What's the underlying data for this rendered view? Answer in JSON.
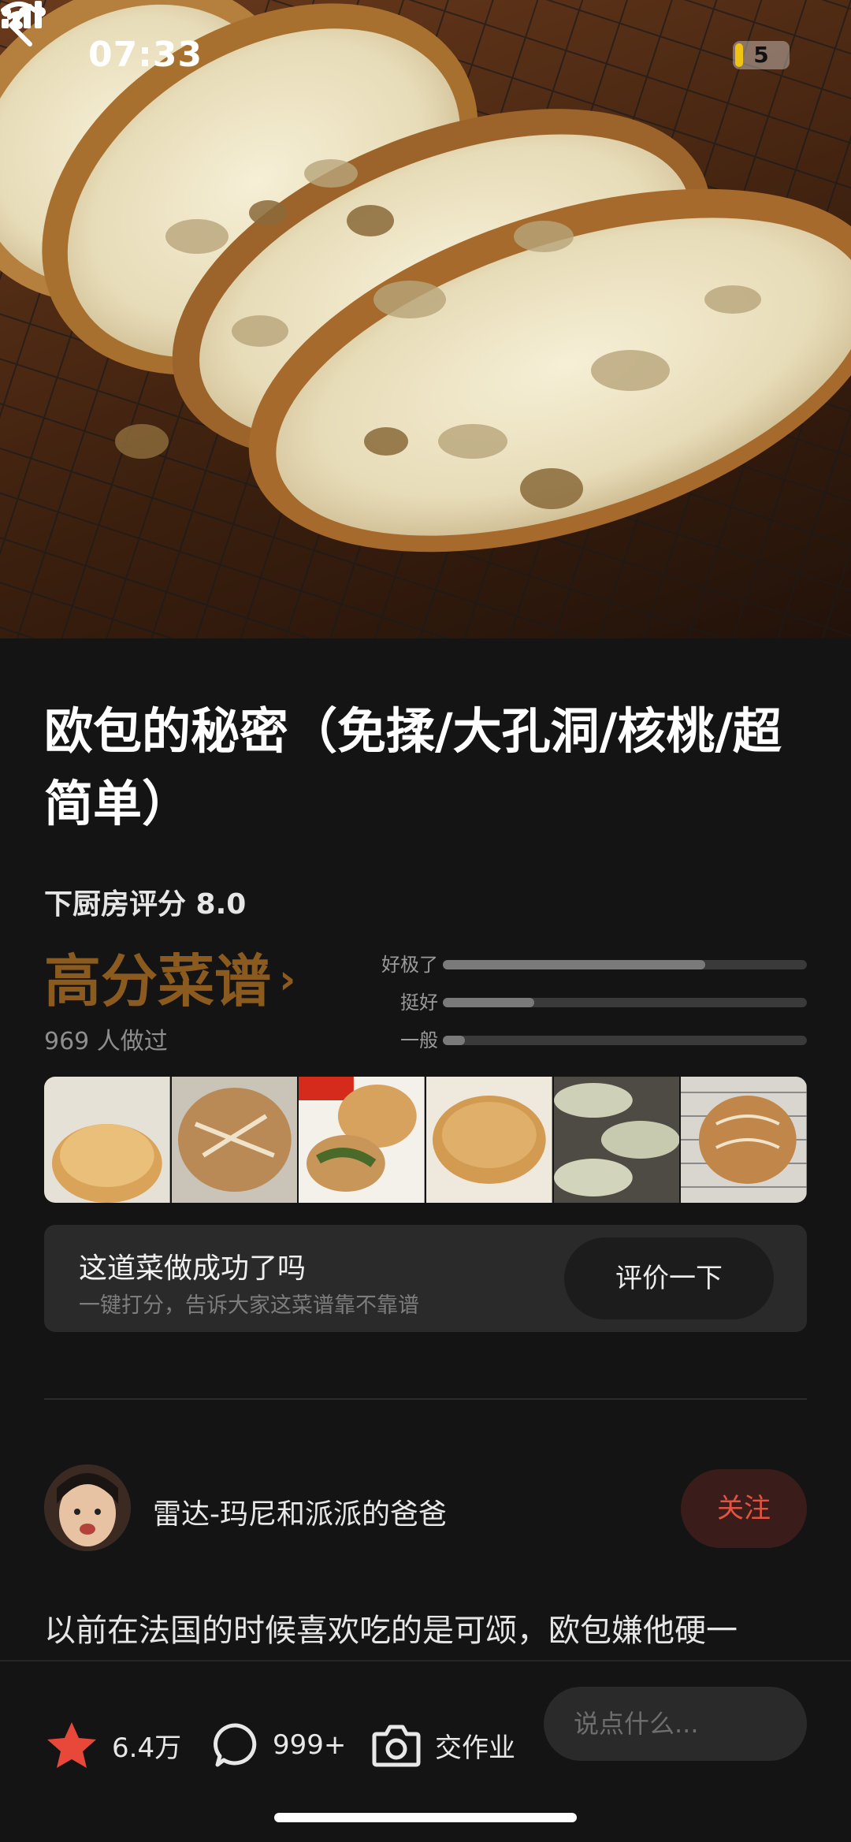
{
  "status_bar": {
    "time": "07:33",
    "battery": "5"
  },
  "recipe": {
    "title": "欧包的秘密（免揉/大孔洞/核桃/超简单）",
    "rating_label": "下厨房评分 8.0",
    "badge": "高分菜谱",
    "badge_chevron": "›",
    "made_count": "969 人做过",
    "distribution": [
      {
        "label": "好极了",
        "fraction": 0.72
      },
      {
        "label": "挺好",
        "fraction": 0.25
      },
      {
        "label": "一般",
        "fraction": 0.06
      }
    ]
  },
  "review_card": {
    "question": "这道菜做成功了吗",
    "subtitle": "一键打分，告诉大家这菜谱靠不靠谱",
    "button": "评价一下"
  },
  "author": {
    "name": "雷达-玛尼和派派的爸爸",
    "follow": "关注"
  },
  "intro_text": "以前在法国的时候喜欢吃的是可颂，欧包嫌他硬一",
  "bottom_bar": {
    "favorites": "6.4万",
    "comments": "999+",
    "homework": "交作业",
    "comment_placeholder": "说点什么..."
  },
  "colors": {
    "accent_gold": "#8a5a1e",
    "follow_red": "#e4533f",
    "star_red": "#e8483a"
  }
}
